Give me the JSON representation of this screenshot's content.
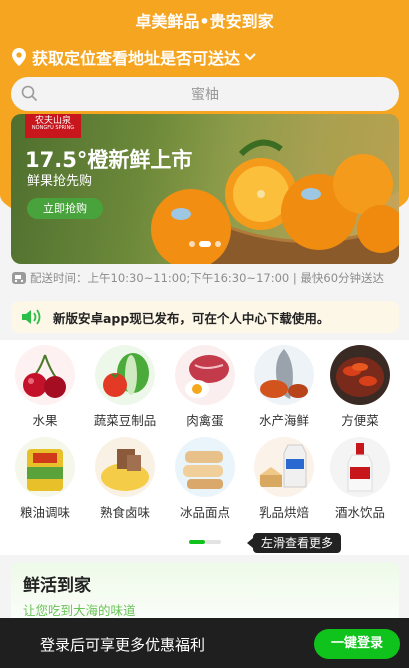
{
  "header": {
    "store_title": "卓美鲜品•贵安到家",
    "location_text": "获取定位查看地址是否可送达"
  },
  "search": {
    "placeholder": "蜜柚"
  },
  "banner": {
    "brand_cn": "农夫山泉",
    "brand_en": "NONGFU SPRING",
    "headline": "17.5°橙新鲜上市",
    "subtitle": "鲜果抢先购",
    "cta": "立即抢购"
  },
  "delivery": {
    "text": "配送时间：上午10:30~11:00;下午16:30~17:00 | 最快60分钟送达"
  },
  "notice": {
    "text": "新版安卓app现已发布，可在个人中心下载使用。"
  },
  "categories": [
    {
      "label": "水果",
      "icon": "cherry-icon"
    },
    {
      "label": "蔬菜豆制品",
      "icon": "vegetable-icon"
    },
    {
      "label": "肉禽蛋",
      "icon": "meat-egg-icon"
    },
    {
      "label": "水产海鲜",
      "icon": "seafood-icon"
    },
    {
      "label": "方便菜",
      "icon": "crayfish-icon"
    },
    {
      "label": "粮油调味",
      "icon": "rice-bag-icon"
    },
    {
      "label": "熟食卤味",
      "icon": "braised-food-icon"
    },
    {
      "label": "冰品面点",
      "icon": "bread-icon"
    },
    {
      "label": "乳品烘焙",
      "icon": "dairy-icon"
    },
    {
      "label": "酒水饮品",
      "icon": "liquor-icon"
    }
  ],
  "swipe_tip": "左滑查看更多",
  "fresh": {
    "title": "鲜活到家",
    "subtitle": "让您吃到大海的味道"
  },
  "login_bar": {
    "message": "登录后可享更多优惠福利",
    "button": "一键登录"
  },
  "colors": {
    "brand_orange": "#f6a520",
    "accent_green": "#10c31c",
    "bar_dark": "#1f1f1f"
  }
}
